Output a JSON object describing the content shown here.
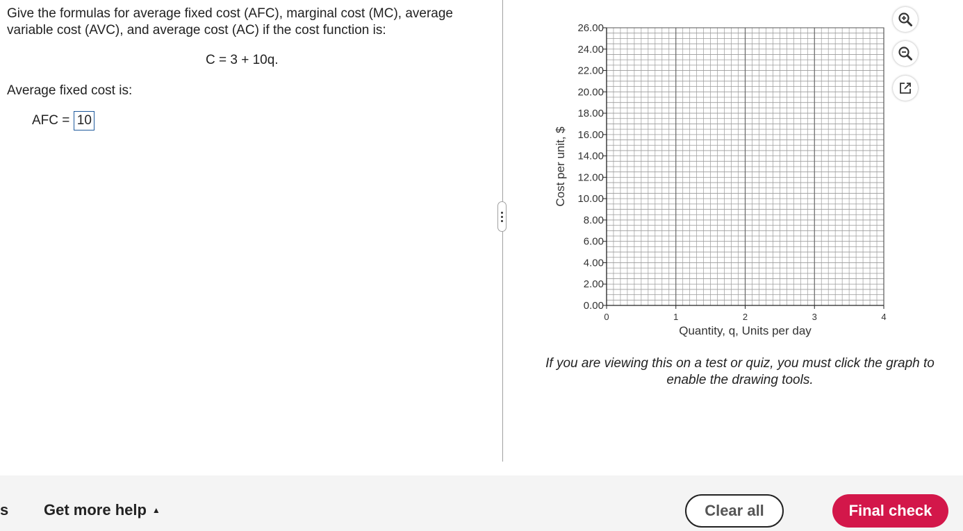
{
  "question": {
    "prompt": "Give the formulas for average fixed cost (AFC), marginal cost (MC), average variable cost (AVC), and average cost (AC) if the cost function is:",
    "equation": "C = 3 + 10q.",
    "afc_label": "Average fixed cost is:",
    "afc_prefix": "AFC =",
    "afc_value": "10"
  },
  "graph": {
    "note": "If you are viewing this on a test or quiz, you must click the graph to enable the drawing tools.",
    "tools": [
      "zoom-in-icon",
      "zoom-out-icon",
      "pop-out-icon"
    ]
  },
  "chart_data": {
    "type": "line",
    "title": "",
    "xlabel": "Quantity, q, Units per day",
    "ylabel": "Cost per unit, $",
    "xlim": [
      0,
      4
    ],
    "ylim": [
      0,
      26
    ],
    "x_ticks": [
      "0",
      "1",
      "2",
      "3",
      "4"
    ],
    "y_ticks": [
      "0.00",
      "2.00",
      "4.00",
      "6.00",
      "8.00",
      "10.00",
      "12.00",
      "14.00",
      "16.00",
      "18.00",
      "20.00",
      "22.00",
      "24.00",
      "26.00"
    ],
    "grid": true,
    "series": []
  },
  "footer": {
    "left_partial": "s",
    "help_label": "Get more help",
    "help_caret": "▲",
    "clear_label": "Clear all",
    "final_label": "Final check"
  },
  "colors": {
    "accent": "#d3174a",
    "input_border": "#1e5a9c"
  }
}
